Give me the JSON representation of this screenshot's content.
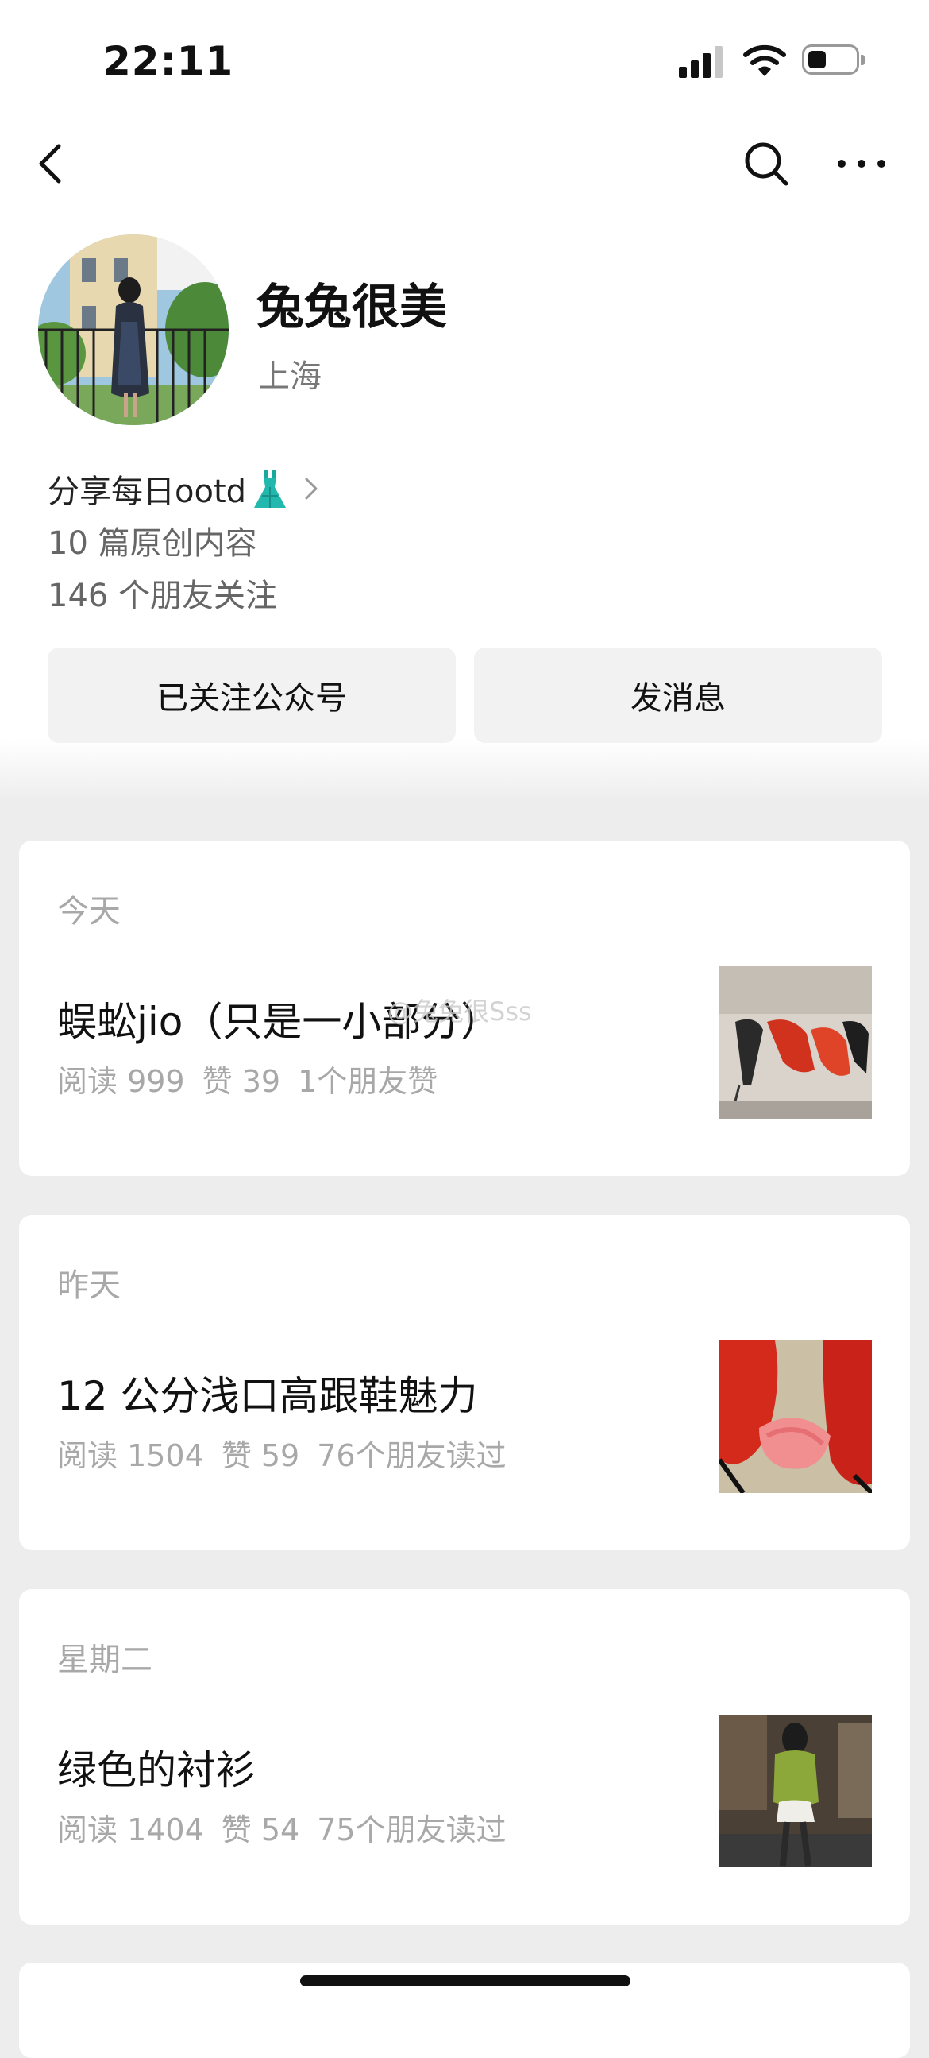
{
  "status_bar": {
    "time": "22:11"
  },
  "profile": {
    "name": "兔兔很美",
    "location": "上海",
    "bio": "分享每日ootd",
    "original_count": "10 篇原创内容",
    "followers": "146 个朋友关注"
  },
  "actions": {
    "followed_label": "已关注公众号",
    "message_label": "发消息"
  },
  "articles": [
    {
      "date": "今天",
      "title": "蜈蚣jio（只是一小部分）",
      "reads": "阅读 999",
      "likes": "赞 39",
      "social": "1个朋友赞"
    },
    {
      "date": "昨天",
      "title": "12 公分浅口高跟鞋魅力",
      "reads": "阅读 1504",
      "likes": "赞 59",
      "social": "76个朋友读过"
    },
    {
      "date": "星期二",
      "title": "绿色的衬衫",
      "reads": "阅读 1404",
      "likes": "赞 54",
      "social": "75个朋友读过"
    }
  ],
  "watermark": "@兔兔很Sss",
  "icons": {
    "back": "chevron-left-icon",
    "search": "search-icon",
    "more": "more-dots-icon",
    "bio_emoji": "dress-icon",
    "bio_chevron": "chevron-right-icon"
  }
}
